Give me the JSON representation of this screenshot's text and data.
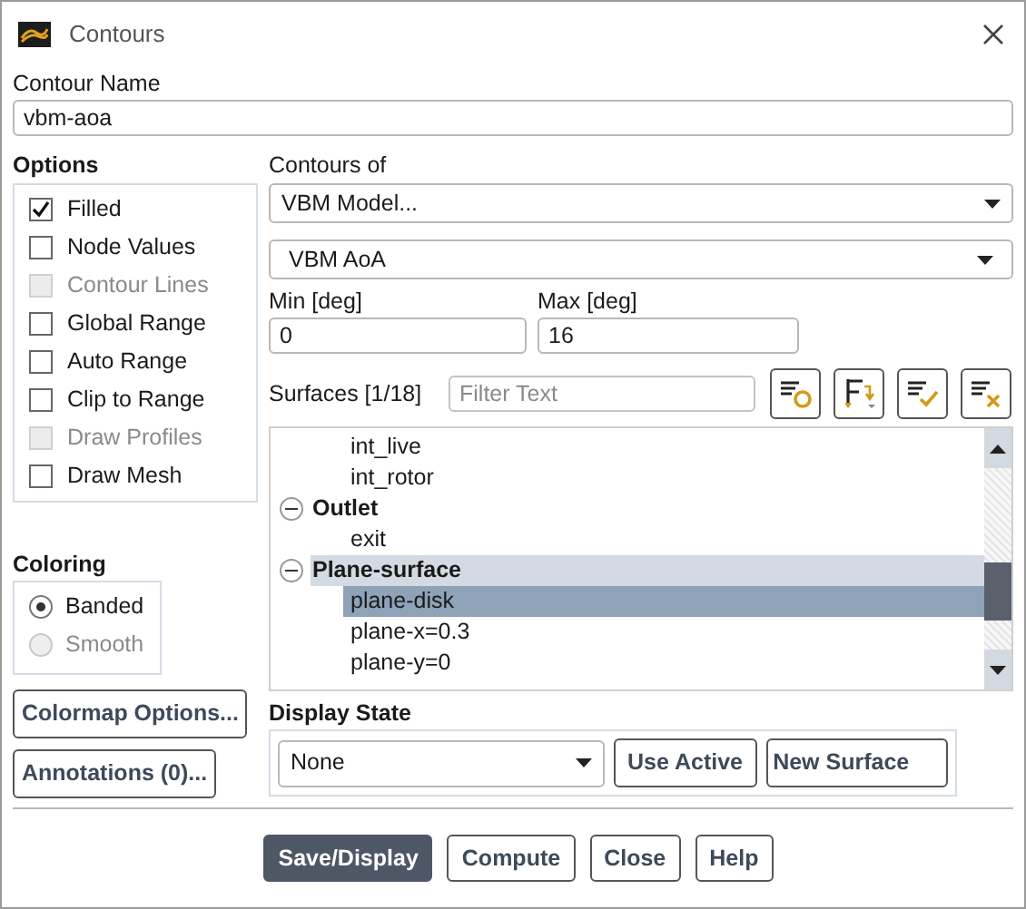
{
  "window": {
    "title": "Contours"
  },
  "contour_name": {
    "label": "Contour Name",
    "value": "vbm-aoa"
  },
  "options": {
    "label": "Options",
    "items": [
      {
        "label": "Filled",
        "checked": true,
        "disabled": false
      },
      {
        "label": "Node Values",
        "checked": false,
        "disabled": false
      },
      {
        "label": "Contour Lines",
        "checked": false,
        "disabled": true
      },
      {
        "label": "Global Range",
        "checked": false,
        "disabled": false
      },
      {
        "label": "Auto Range",
        "checked": false,
        "disabled": false
      },
      {
        "label": "Clip to Range",
        "checked": false,
        "disabled": false
      },
      {
        "label": "Draw Profiles",
        "checked": false,
        "disabled": true
      },
      {
        "label": "Draw Mesh",
        "checked": false,
        "disabled": false
      }
    ]
  },
  "coloring": {
    "label": "Coloring",
    "items": [
      {
        "label": "Banded",
        "selected": true,
        "disabled": false
      },
      {
        "label": "Smooth",
        "selected": false,
        "disabled": true
      }
    ]
  },
  "left_buttons": [
    "Colormap Options...",
    "Annotations (0)..."
  ],
  "contours_of": {
    "label": "Contours of",
    "category": "VBM Model...",
    "variable": "VBM AoA"
  },
  "min": {
    "label": "Min [deg]",
    "value": "0"
  },
  "max": {
    "label": "Max [deg]",
    "value": "16"
  },
  "surfaces": {
    "label": "Surfaces [1/18]",
    "filter_placeholder": "Filter Text",
    "tree": [
      {
        "label": "int_live",
        "selected": false
      },
      {
        "label": "int_rotor",
        "selected": false
      },
      {
        "label": "Outlet",
        "expanded": true,
        "highlighted": false,
        "children": [
          {
            "label": "exit",
            "selected": false
          }
        ]
      },
      {
        "label": "Plane-surface",
        "expanded": true,
        "highlighted": true,
        "children": [
          {
            "label": "plane-disk",
            "selected": true
          },
          {
            "label": "plane-x=0.3",
            "selected": false
          },
          {
            "label": "plane-y=0",
            "selected": false
          }
        ]
      }
    ]
  },
  "display_state": {
    "label": "Display State",
    "value": "None",
    "buttons": [
      "Use Active",
      "New Surface"
    ]
  },
  "actions": [
    {
      "label": "Save/Display",
      "primary": true
    },
    {
      "label": "Compute",
      "primary": false
    },
    {
      "label": "Close",
      "primary": false
    },
    {
      "label": "Help",
      "primary": false
    }
  ]
}
